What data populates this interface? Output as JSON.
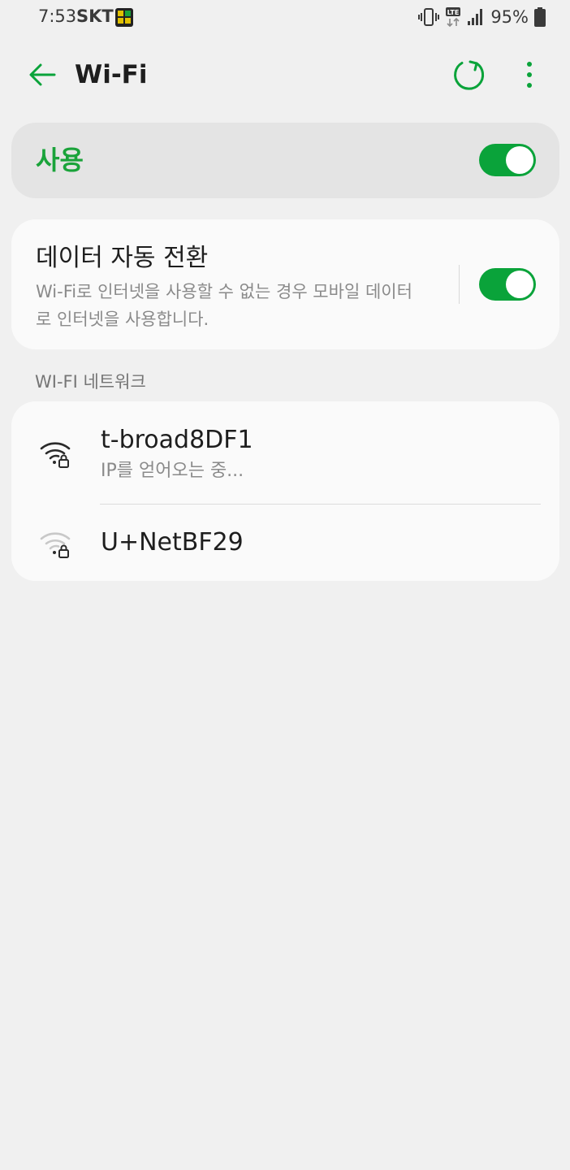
{
  "status_bar": {
    "time": "7:53",
    "carrier": "SKT",
    "battery_percent": "95%",
    "icons": [
      "sim-icon",
      "vibrate-icon",
      "lte-icon",
      "signal-icon",
      "battery-icon"
    ]
  },
  "app_bar": {
    "title": "Wi-Fi",
    "icons": [
      "back-arrow-icon",
      "refresh-icon",
      "more-vertical-icon"
    ]
  },
  "master_switch": {
    "label": "사용",
    "on": true
  },
  "auto_switch": {
    "title": "데이터 자동 전환",
    "description": "Wi-Fi로 인터넷을 사용할 수 없는 경우 모바일 데이터로 인터넷을 사용합니다.",
    "on": true
  },
  "networks_section": {
    "header": "WI-FI 네트워크",
    "items": [
      {
        "name": "t-broad8DF1",
        "status": "IP를 얻어오는 중...",
        "icon": "wifi-locked-icon",
        "signal_bars": 3
      },
      {
        "name": "U+NetBF29",
        "icon": "wifi-locked-icon",
        "signal_bars": 1
      }
    ]
  },
  "colors": {
    "accent": "#0aa33a",
    "background": "#f0f0f0",
    "card": "#fafafa",
    "master_card": "#e4e4e4"
  }
}
